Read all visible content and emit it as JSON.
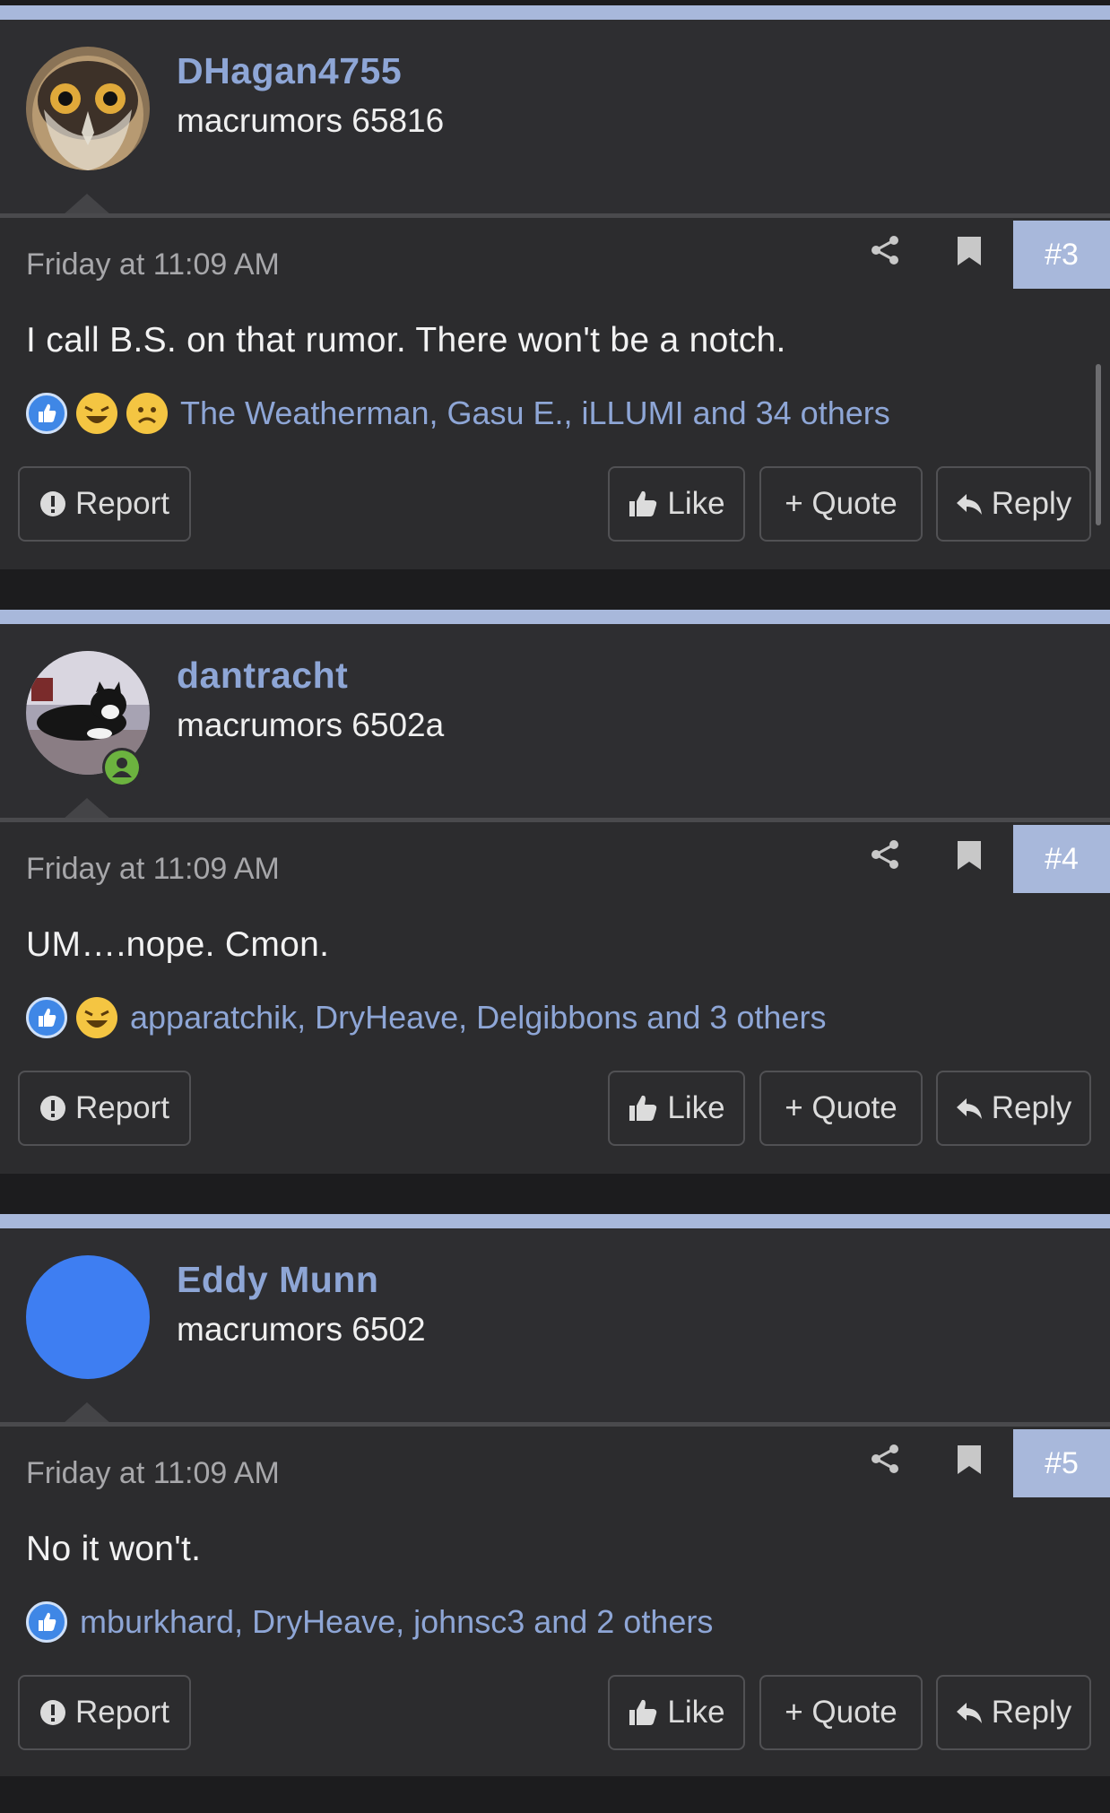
{
  "posts": [
    {
      "username": "DHagan4755",
      "user_title": "macrumors 65816",
      "avatar": "owl-avatar",
      "date": "Friday at 11:09 AM",
      "post_number": "#3",
      "message": "I call B.S. on that rumor. There won't be a notch.",
      "reactions": [
        "like",
        "haha",
        "sad"
      ],
      "reacted_by": "The Weatherman, Gasu E., iLLUMI and 34 others"
    },
    {
      "username": "dantracht",
      "user_title": "macrumors 6502a",
      "avatar": "cat-avatar",
      "date": "Friday at 11:09 AM",
      "post_number": "#4",
      "message": "UM….nope. Cmon.",
      "reactions": [
        "like",
        "haha"
      ],
      "reacted_by": "apparatchik, DryHeave, Delgibbons and 3 others"
    },
    {
      "username": "Eddy Munn",
      "user_title": "macrumors 6502",
      "avatar": "blue-circle-avatar",
      "date": "Friday at 11:09 AM",
      "post_number": "#5",
      "message": "No it won't.",
      "reactions": [
        "like"
      ],
      "reacted_by": "mburkhard, DryHeave, johnsc3 and 2 others"
    }
  ],
  "buttons": {
    "report": "Report",
    "like": "Like",
    "quote": "+ Quote",
    "reply": "Reply"
  },
  "colors": {
    "accent": "#a8b8db",
    "link": "#8ea6d6",
    "online": "#6cb33f"
  },
  "icons": [
    "share-icon",
    "bookmark-icon",
    "report-icon",
    "thumbs-up-icon",
    "reply-icon",
    "online-status-icon"
  ]
}
